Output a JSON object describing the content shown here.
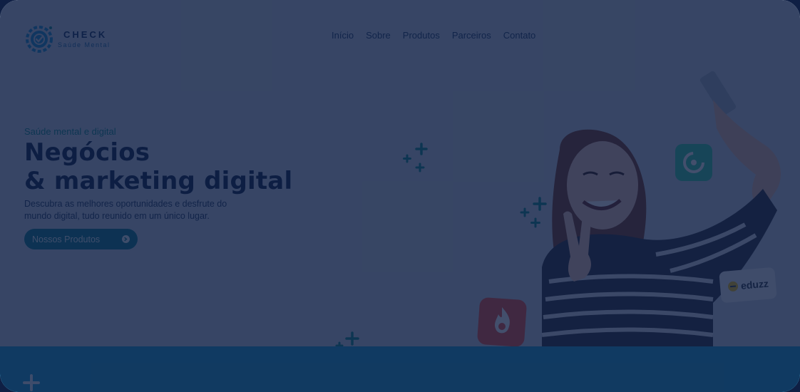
{
  "brand": {
    "name": "CHECK",
    "subtitle": "Saúde Mental"
  },
  "nav": {
    "items": [
      {
        "label": "Início"
      },
      {
        "label": "Sobre"
      },
      {
        "label": "Produtos"
      },
      {
        "label": "Parceiros"
      },
      {
        "label": "Contato"
      }
    ]
  },
  "hero": {
    "kicker": "Saúde mental e digital",
    "headline_line1": "Negócios",
    "headline_line2": "& marketing digital",
    "description": "Descubra as melhores oportunidades e desfrute do mundo digital, tudo reunido em um único lugar.",
    "cta_label": "Nossos Produtos",
    "cta_icon": "arrow-circle-icon"
  },
  "partners": {
    "eduzz_label": "eduzz"
  },
  "colors": {
    "accent": "#0a7d8c",
    "headline": "#0d2147",
    "band": "#1a9ed1",
    "overlay": "#0e1e42"
  }
}
